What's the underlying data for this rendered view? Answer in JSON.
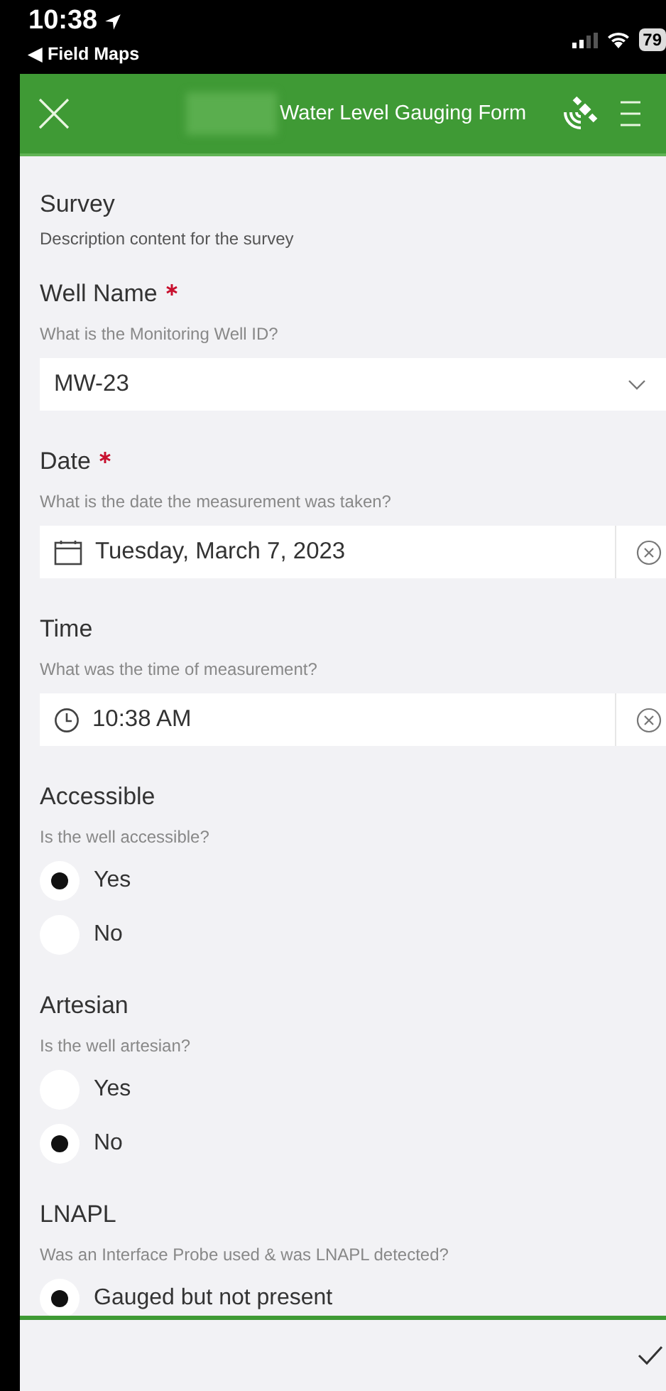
{
  "status_bar": {
    "time": "10:38",
    "back_app": "◀ Field Maps",
    "battery": "79"
  },
  "header": {
    "title": "Water Level Gauging Form"
  },
  "survey": {
    "title": "Survey",
    "description": "Description content for the survey"
  },
  "fields": [
    {
      "kind": "select",
      "label": "Well Name",
      "required": true,
      "hint": "What is the Monitoring Well ID?",
      "value": "MW-23"
    },
    {
      "kind": "date",
      "label": "Date",
      "required": true,
      "hint": "What is the date the measurement was taken?",
      "value": "Tuesday, March 7, 2023"
    },
    {
      "kind": "time",
      "label": "Time",
      "required": false,
      "hint": "What was the time of measurement?",
      "value": "10:38 AM"
    },
    {
      "kind": "radio",
      "label": "Accessible",
      "hint": "Is the well accessible?",
      "options": [
        {
          "label": "Yes",
          "selected": true
        },
        {
          "label": "No",
          "selected": false
        }
      ]
    },
    {
      "kind": "radio",
      "label": "Artesian",
      "hint": "Is the well artesian?",
      "options": [
        {
          "label": "Yes",
          "selected": false
        },
        {
          "label": "No",
          "selected": true
        }
      ]
    },
    {
      "kind": "radio",
      "label": "LNAPL",
      "hint": "Was an Interface Probe used & was LNAPL detected?",
      "options": [
        {
          "label": "Gauged but not present",
          "selected": true
        }
      ]
    }
  ]
}
